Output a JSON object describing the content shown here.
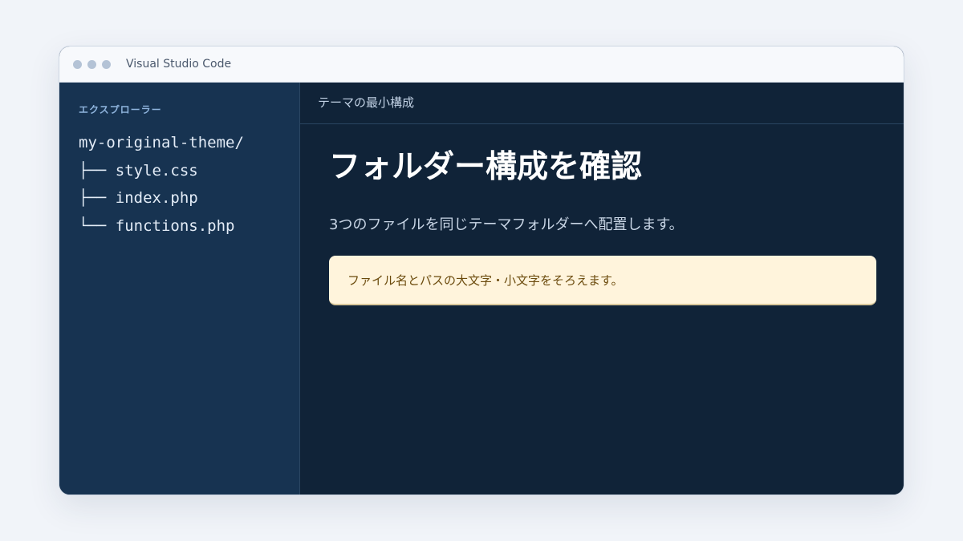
{
  "window": {
    "title": "Visual Studio Code"
  },
  "sidebar": {
    "heading": "エクスプローラー",
    "tree": [
      "my-original-theme/",
      "├── style.css",
      "├── index.php",
      "└── functions.php"
    ]
  },
  "editor": {
    "tab_label": "テーマの最小構成",
    "title": "フォルダー構成を確認",
    "description": "3つのファイルを同じテーマフォルダーへ配置します。",
    "note": "ファイル名とパスの大文字・小文字をそろえます。"
  },
  "colors": {
    "editor_background": "#102338",
    "sidebar_background": "#173351",
    "note_background": "#fff4dc",
    "note_text": "#6b4a0c"
  }
}
